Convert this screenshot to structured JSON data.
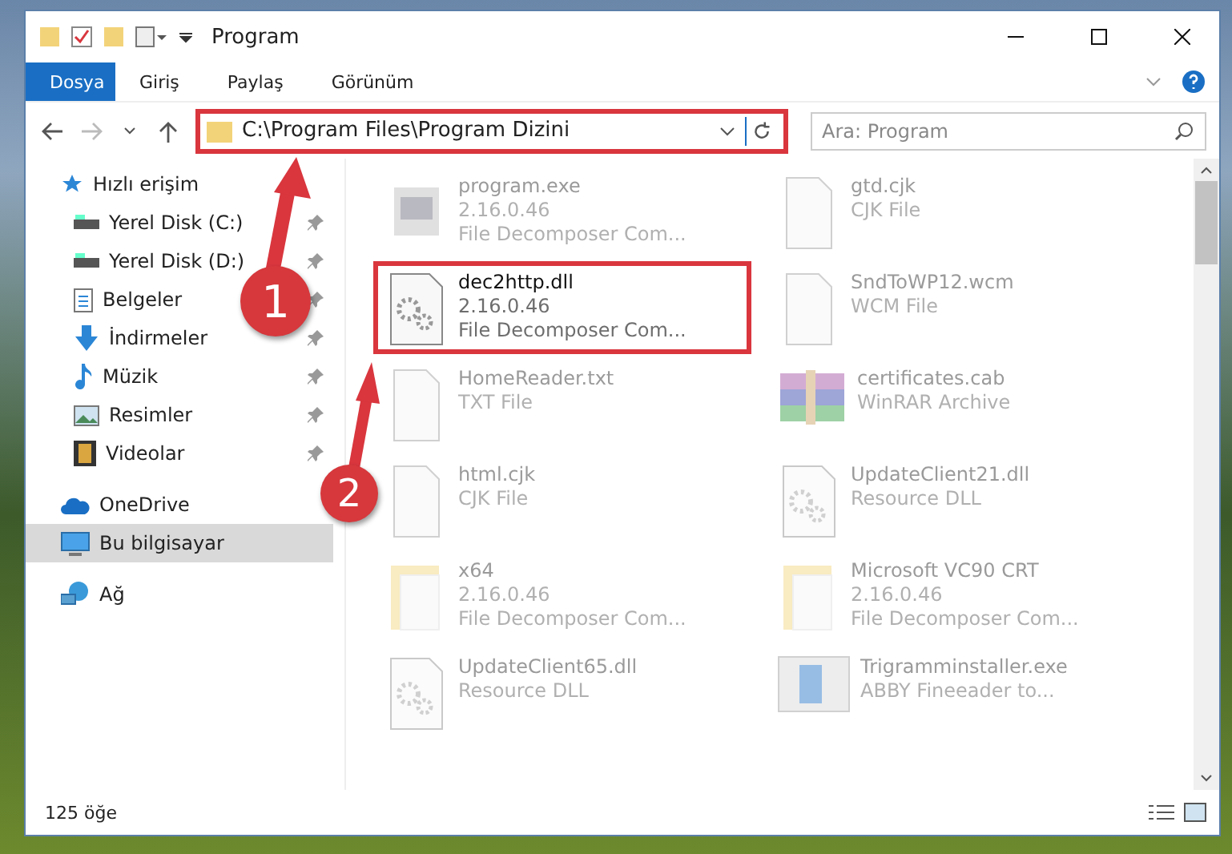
{
  "window": {
    "title": "Program"
  },
  "ribbon_tabs": [
    {
      "label": "Dosya",
      "selected": true
    },
    {
      "label": "Giriş",
      "selected": false
    },
    {
      "label": "Paylaş",
      "selected": false
    },
    {
      "label": "Görünüm",
      "selected": false
    }
  ],
  "address_bar": {
    "path": "C:\\Program Files\\Program Dizini",
    "callout": true
  },
  "search": {
    "placeholder": "Ara: Program"
  },
  "sidebar": {
    "items": [
      {
        "label": "Hızlı erişim",
        "selected": false,
        "children": [
          {
            "label": "Yerel Disk (C:)",
            "pinned": true,
            "selected": false
          },
          {
            "label": "Yerel Disk (D:)",
            "pinned": true,
            "selected": false
          },
          {
            "label": "Belgeler",
            "pinned": true,
            "selected": false
          },
          {
            "label": "İndirmeler",
            "pinned": true,
            "selected": false
          },
          {
            "label": "Müzik",
            "pinned": true,
            "selected": false
          },
          {
            "label": "Resimler",
            "pinned": true,
            "selected": false
          },
          {
            "label": "Videolar",
            "pinned": true,
            "selected": false
          }
        ]
      },
      {
        "label": "OneDrive",
        "selected": false
      },
      {
        "label": "Bu bilgisayar",
        "selected": true
      },
      {
        "label": "Ağ",
        "selected": false
      }
    ]
  },
  "files": [
    {
      "kind": "app",
      "name": "program.exe",
      "lines": [
        "2.16.0.46",
        "File Decomposer Com..."
      ],
      "blurred": true,
      "callout": false
    },
    {
      "kind": "blank",
      "name": "gtd.cjk",
      "lines": [
        "CJK File"
      ],
      "blurred": true,
      "callout": false
    },
    {
      "kind": "gear",
      "name": "dec2http.dll",
      "lines": [
        "2.16.0.46",
        "File Decomposer Com..."
      ],
      "blurred": false,
      "callout": true
    },
    {
      "kind": "blank",
      "name": "SndToWP12.wcm",
      "lines": [
        "WCM File"
      ],
      "blurred": true,
      "callout": false
    },
    {
      "kind": "blank",
      "name": "HomeReader.txt",
      "lines": [
        "TXT File"
      ],
      "blurred": true,
      "callout": false
    },
    {
      "kind": "archive",
      "name": "certificates.cab",
      "lines": [
        "WinRAR Archive"
      ],
      "blurred": true,
      "callout": false
    },
    {
      "kind": "blank",
      "name": "html.cjk",
      "lines": [
        "CJK File"
      ],
      "blurred": true,
      "callout": false
    },
    {
      "kind": "gear",
      "name": "UpdateClient21.dll",
      "lines": [
        "Resource DLL"
      ],
      "blurred": true,
      "callout": false
    },
    {
      "kind": "folder",
      "name": "x64",
      "lines": [
        "2.16.0.46",
        "File Decomposer Com..."
      ],
      "blurred": true,
      "callout": false
    },
    {
      "kind": "folder",
      "name": "Microsoft VC90 CRT",
      "lines": [
        "2.16.0.46",
        "File Decomposer Com..."
      ],
      "blurred": true,
      "callout": false
    },
    {
      "kind": "gear",
      "name": "UpdateClient65.dll",
      "lines": [
        "Resource DLL"
      ],
      "blurred": true,
      "callout": false
    },
    {
      "kind": "installer",
      "name": "Trigramminstaller.exe",
      "lines": [
        "ABBY Fineeader to..."
      ],
      "blurred": true,
      "callout": false
    }
  ],
  "status_bar": {
    "count": "125 öğe"
  },
  "annotations": [
    {
      "label": "1"
    },
    {
      "label": "2"
    }
  ]
}
